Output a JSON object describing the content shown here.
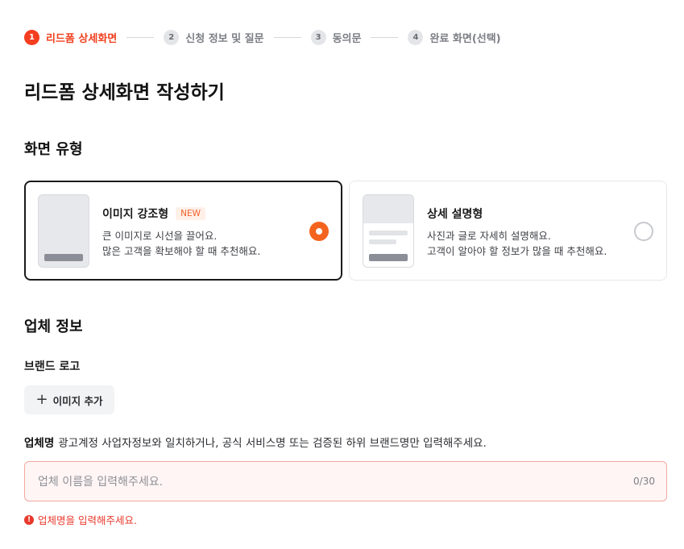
{
  "stepper": {
    "steps": [
      {
        "num": "1",
        "label": "리드폼 상세화면"
      },
      {
        "num": "2",
        "label": "신청 정보 및 질문"
      },
      {
        "num": "3",
        "label": "동의문"
      },
      {
        "num": "4",
        "label": "완료 화면(선택)"
      }
    ],
    "active_step": 1
  },
  "page_title": "리드폼 상세화면 작성하기",
  "screen_type": {
    "title": "화면 유형",
    "options": [
      {
        "title": "이미지 강조형",
        "badge": "NEW",
        "desc_line1": "큰 이미지로 시선을 끌어요.",
        "desc_line2": "많은 고객을 확보해야 할 때 추천해요.",
        "selected": true
      },
      {
        "title": "상세 설명형",
        "desc_line1": "사진과 글로 자세히 설명해요.",
        "desc_line2": "고객이 알아야 할 정보가 많을 때 추천해요.",
        "selected": false
      }
    ]
  },
  "company_info": {
    "title": "업체 정보",
    "brand_logo": {
      "label": "브랜드 로고",
      "add_button": "이미지 추가",
      "add_icon": "plus-icon"
    },
    "company_name": {
      "label": "업체명",
      "help": "광고계정 사업자정보와 일치하거나, 공식 서비스명 또는 검증된 하위 브랜드명만 입력해주세요.",
      "value": "",
      "placeholder": "업체 이름을 입력해주세요.",
      "counter": "0/30",
      "error": "업체명을 입력해주세요.",
      "error_icon": "!"
    }
  },
  "colors": {
    "accent": "#f53d1f",
    "radio_selected": "#f4641f",
    "error": "#e8392c",
    "error_border": "#f3a8a0",
    "error_bg": "#fff5f5"
  }
}
